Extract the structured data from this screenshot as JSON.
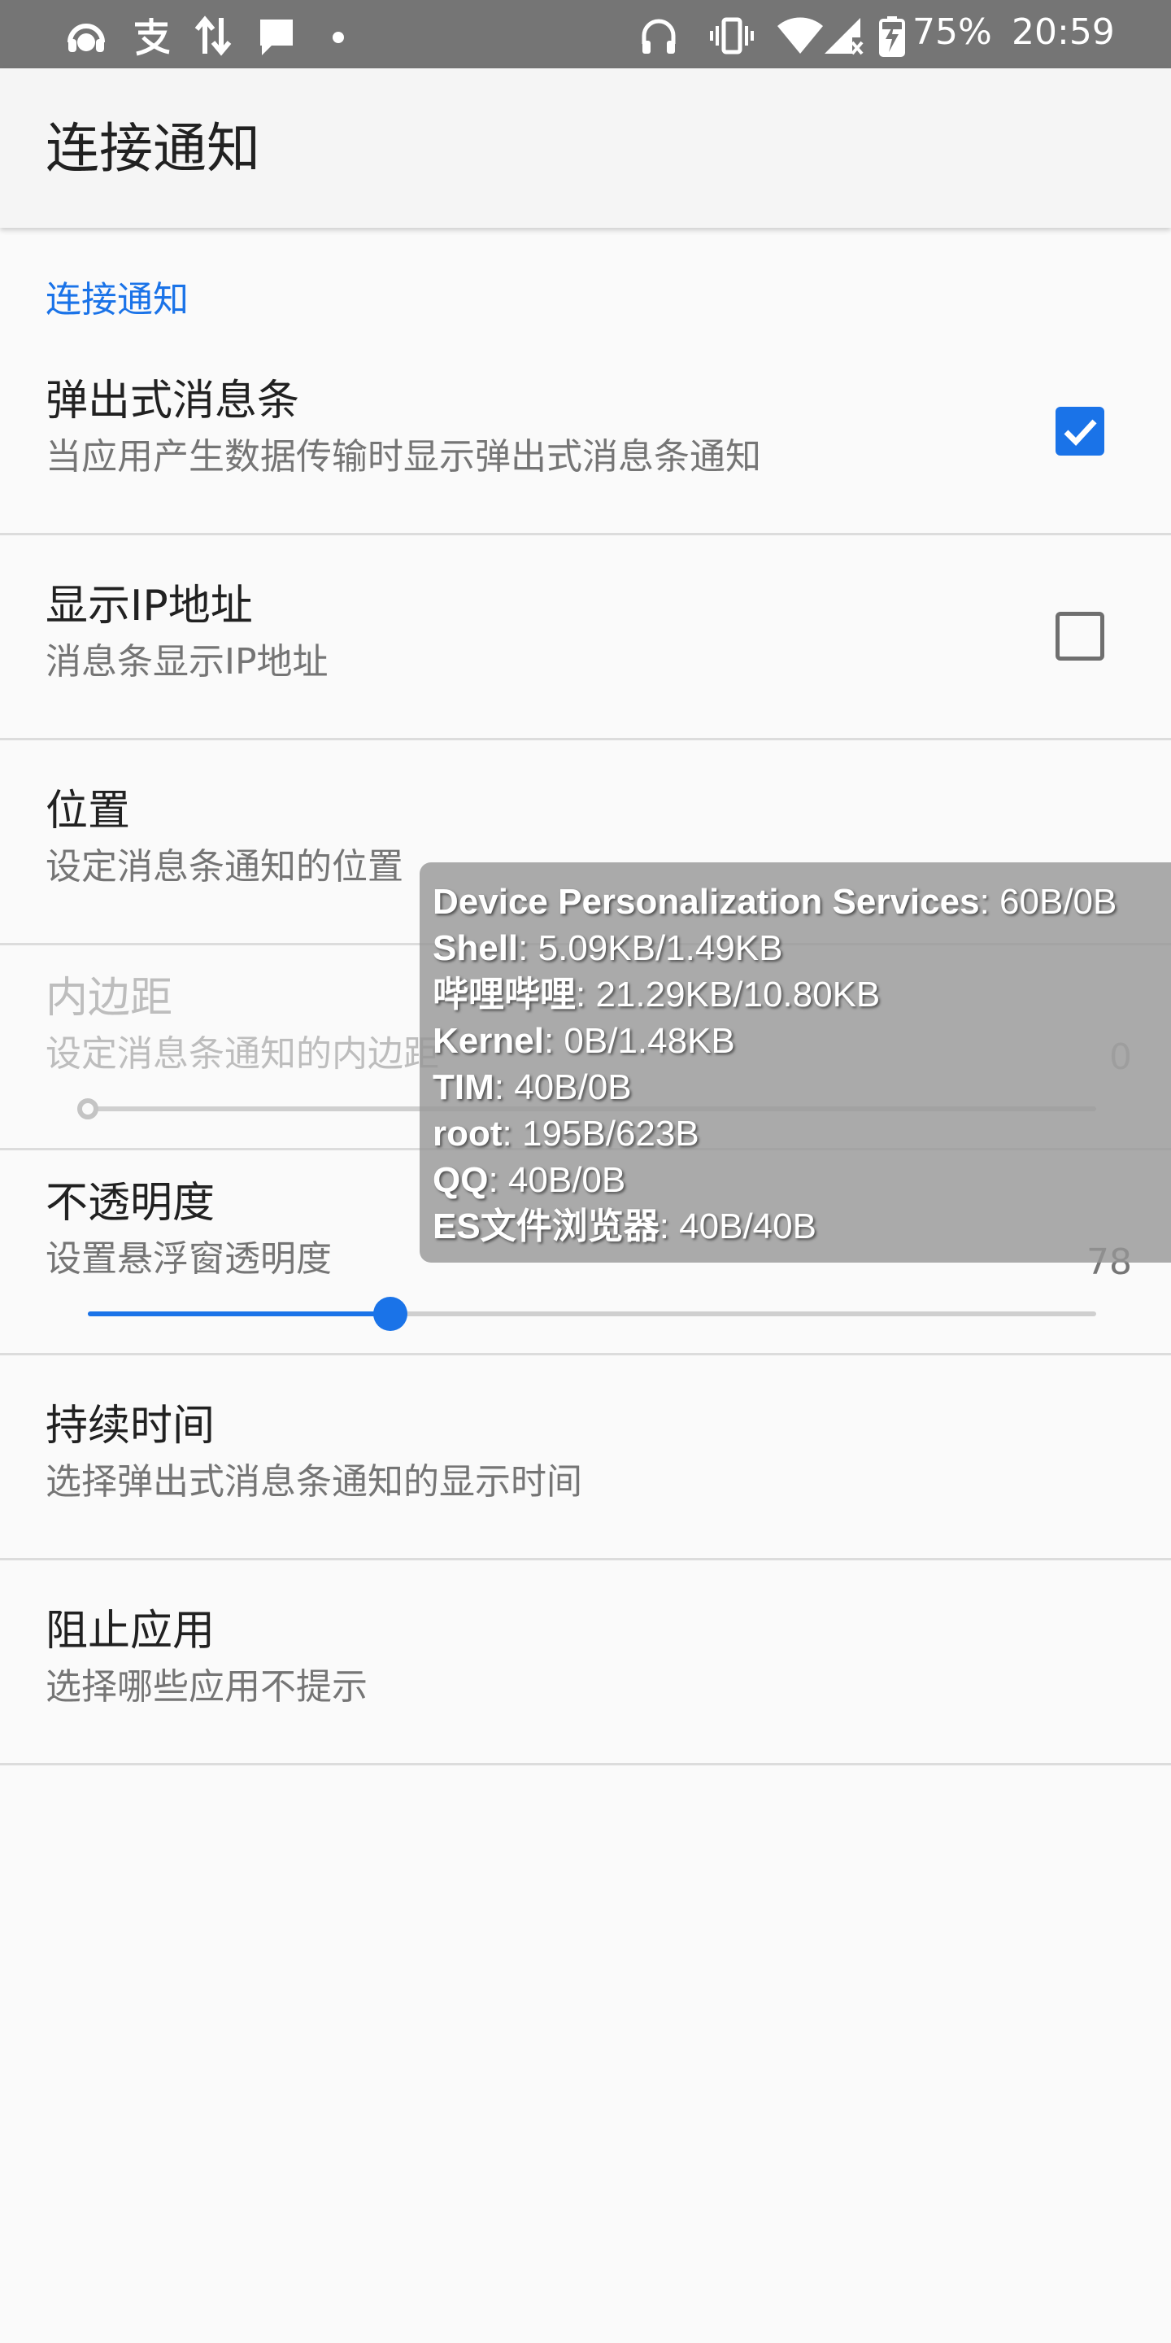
{
  "status_bar": {
    "battery": "75%",
    "time": "20:59",
    "icons": [
      "music-app-icon",
      "alipay-icon",
      "data-transfer-icon",
      "chat-bubble-icon",
      "dot-icon",
      "headphones-icon",
      "vibrate-icon",
      "wifi-icon",
      "signal-icon",
      "battery-charging-icon"
    ]
  },
  "app_bar": {
    "title": "连接通知"
  },
  "section": {
    "header": "连接通知"
  },
  "prefs": {
    "popup": {
      "title": "弹出式消息条",
      "summary": "当应用产生数据传输时显示弹出式消息条通知",
      "checked": true
    },
    "show_ip": {
      "title": "显示IP地址",
      "summary": "消息条显示IP地址",
      "checked": false
    },
    "position": {
      "title": "位置",
      "summary": "设定消息条通知的位置"
    },
    "padding": {
      "title": "内边距",
      "summary": "设定消息条通知的内边距",
      "value": "0",
      "fraction": 0
    },
    "opacity": {
      "title": "不透明度",
      "summary": "设置悬浮窗透明度",
      "value": "78",
      "fraction": 0.3
    },
    "duration": {
      "title": "持续时间",
      "summary": "选择弹出式消息条通知的显示时间"
    },
    "block_apps": {
      "title": "阻止应用",
      "summary": "选择哪些应用不提示"
    }
  },
  "overlay": {
    "entries": [
      {
        "name": "Device Personalization Services",
        "value": ": 60B/0B"
      },
      {
        "name": "Shell",
        "value": ": 5.09KB/1.49KB"
      },
      {
        "name": "哔哩哔哩",
        "value": ": 21.29KB/10.80KB"
      },
      {
        "name": "Kernel",
        "value": ": 0B/1.48KB"
      },
      {
        "name": "TIM",
        "value": ": 40B/0B"
      },
      {
        "name": "root",
        "value": ": 195B/623B"
      },
      {
        "name": "QQ",
        "value": ": 40B/0B"
      },
      {
        "name": "ES文件浏览器",
        "value": ": 40B/40B"
      }
    ]
  },
  "colors": {
    "accent": "#1a73e8",
    "status_bar": "#757575",
    "background": "#fafafa"
  }
}
